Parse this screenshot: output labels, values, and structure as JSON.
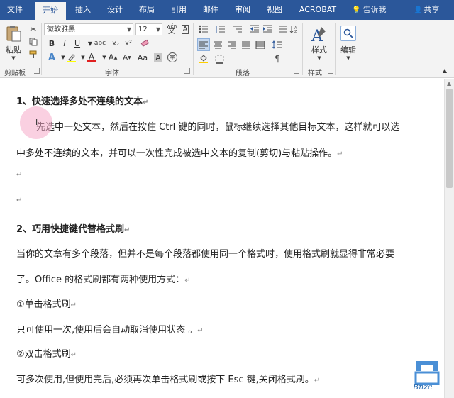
{
  "tabs": [
    {
      "label": "文件"
    },
    {
      "label": "开始"
    },
    {
      "label": "插入"
    },
    {
      "label": "设计"
    },
    {
      "label": "布局"
    },
    {
      "label": "引用"
    },
    {
      "label": "邮件"
    },
    {
      "label": "审阅"
    },
    {
      "label": "视图"
    },
    {
      "label": "ACROBAT"
    }
  ],
  "tell_me": "告诉我",
  "share": "共享",
  "ribbon": {
    "paste_label": "粘贴",
    "clipboard_label": "剪贴板",
    "font_name": "微软雅黑",
    "font_size": "12",
    "font_label": "字体",
    "paragraph_label": "段落",
    "styles_button": "样式",
    "styles_label": "样式",
    "edit_button": "编辑",
    "wen_glyph": "wén",
    "bold": "B",
    "italic": "I",
    "underline": "U",
    "strike": "abc",
    "subscript": "x₂",
    "superscript": "x²",
    "font_color_a": "A",
    "grow_a": "A",
    "shrink_a": "A",
    "aa_label": "Aa",
    "char_a": "A",
    "wen_char": "文",
    "a_char": "A"
  },
  "doc": {
    "h1": "1、快速选择多处不连续的文本",
    "p1a": "先选中一处文本，然后在按住 Ctrl 键的同时，鼠标继续选择其他目标文本，这样就可以选",
    "p1b": "中多处不连续的文本，并可以一次性完成被选中文本的复制(剪切)与粘贴操作。",
    "h2": "2、巧用快捷键代替格式刷",
    "p2a": "当你的文章有多个段落，但并不是每个段落都使用同一个格式时，使用格式刷就显得非常必要",
    "p2b": "了。Office 的格式刷都有两种使用方式：",
    "i1": "①单击格式刷",
    "p3": "只可使用一次,使用后会自动取消使用状态 。",
    "i2": "②双击格式刷",
    "p4": "可多次使用,但使用完后,必须再次单击格式刷或按下 Esc 键,关闭格式刷。",
    "mark": "↵"
  },
  "logo_text": "Bnzc"
}
